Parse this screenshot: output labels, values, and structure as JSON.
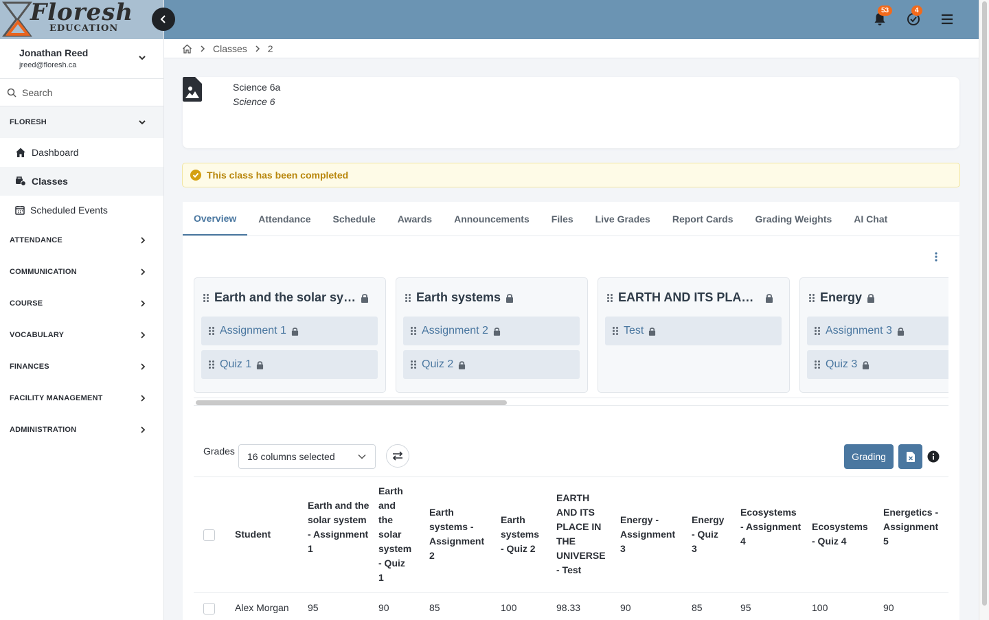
{
  "brand": {
    "logo_text": "Floresh",
    "logo_sub": "EDUCATION"
  },
  "user": {
    "name": "Jonathan Reed",
    "email": "jreed@floresh.ca"
  },
  "search": {
    "placeholder": "Search"
  },
  "sidebar": {
    "group_floresh": "FLORESH",
    "items": [
      {
        "label": "Dashboard",
        "icon": "home-icon"
      },
      {
        "label": "Classes",
        "icon": "classes-icon"
      },
      {
        "label": "Scheduled Events",
        "icon": "calendar-icon"
      }
    ],
    "groups": [
      "ATTENDANCE",
      "COMMUNICATION",
      "COURSE",
      "VOCABULARY",
      "FINANCES",
      "FACILITY MANAGEMENT",
      "ADMINISTRATION"
    ]
  },
  "topbar": {
    "notifications_count": "53",
    "tasks_count": "4"
  },
  "breadcrumb": {
    "level1": "Classes",
    "level2": "2"
  },
  "class_info": {
    "name": "Science 6a",
    "course": "Science 6"
  },
  "alert": {
    "text": "This class has been completed"
  },
  "tabs": [
    "Overview",
    "Attendance",
    "Schedule",
    "Awards",
    "Announcements",
    "Files",
    "Live Grades",
    "Report Cards",
    "Grading Weights",
    "AI Chat"
  ],
  "units": [
    {
      "title": "Earth and the solar sy…",
      "items": [
        "Assignment 1",
        "Quiz 1"
      ]
    },
    {
      "title": "Earth systems",
      "items": [
        "Assignment 2",
        "Quiz 2"
      ]
    },
    {
      "title": "EARTH AND ITS PLA…",
      "items": [
        "Test"
      ]
    },
    {
      "title": "Energy",
      "items": [
        "Assignment 3",
        "Quiz 3"
      ]
    }
  ],
  "grades": {
    "label": "Grades",
    "columns_selected": "16 columns selected",
    "grading_label": "Grading",
    "student_header": "Student",
    "columns": [
      "Earth and the solar system - Assignment 1",
      "Earth and the solar system - Quiz 1",
      "Earth systems - Assignment 2",
      "Earth systems - Quiz 2",
      "EARTH AND ITS PLACE IN THE UNIVERSE - Test",
      "Energy - Assignment 3",
      "Energy - Quiz 3",
      "Ecosystems - Assignment 4",
      "Ecosystems - Quiz 4",
      "Energetics - Assignment 5"
    ],
    "rows": [
      {
        "student": "Alex Morgan",
        "values": [
          "95",
          "90",
          "85",
          "100",
          "98.33",
          "90",
          "85",
          "95",
          "100",
          "90"
        ]
      }
    ]
  },
  "colors": {
    "accent": "#4a77a0",
    "topbar": "#6b94b3",
    "badge": "#f26a1b",
    "alert_text": "#b8860b"
  }
}
